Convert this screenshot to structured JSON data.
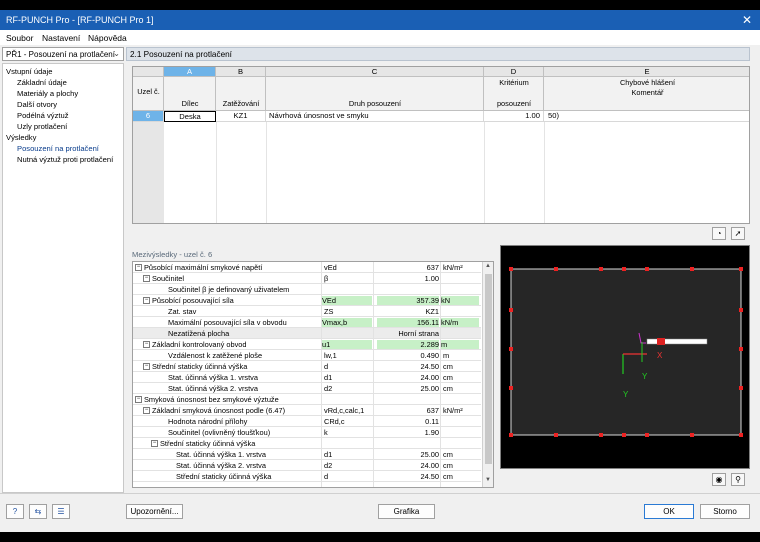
{
  "window": {
    "title": "RF-PUNCH Pro - [RF-PUNCH Pro 1]",
    "close_glyph": "✕"
  },
  "menu": [
    "Soubor",
    "Nastavení",
    "Nápověda"
  ],
  "nav": {
    "selector": "PŘ1 - Posouzení na protlačení",
    "tree": [
      {
        "label": "Vstupní údaje",
        "level": 0
      },
      {
        "label": "Základní údaje",
        "level": 1
      },
      {
        "label": "Materiály a plochy",
        "level": 1
      },
      {
        "label": "Další otvory",
        "level": 1
      },
      {
        "label": "Podélná výztuž",
        "level": 1
      },
      {
        "label": "Uzly protlačení",
        "level": 1
      },
      {
        "label": "Výsledky",
        "level": 0
      },
      {
        "label": "Posouzení na protlačení",
        "level": 1,
        "selected": true
      },
      {
        "label": "Nutná výztuž proti protlačení",
        "level": 1
      }
    ]
  },
  "pane_title": "2.1 Posouzení na protlačení",
  "grid": {
    "col_letters": [
      "A",
      "B",
      "C",
      "D",
      "E"
    ],
    "row_header": "Uzel č.",
    "sub_headers": {
      "A": "Dílec",
      "B": "Zatěžování",
      "C": "Druh posouzení",
      "D1": "Kritérium",
      "D2": "posouzení",
      "E1": "Chybové hlášení",
      "E2": "Komentář"
    },
    "rows": [
      {
        "node": "6",
        "member": "Deska",
        "loading": "KZ1",
        "type": "Návrhová únosnost ve smyku",
        "criterion": "1.00",
        "error_code": "50)"
      }
    ]
  },
  "intermediate": {
    "title": "Mezivýsledky - uzel č. 6",
    "rows": [
      {
        "label": "Působící maximální smykové napětí",
        "indent": 0,
        "toggle": "⊟",
        "sym": "vEd",
        "val": "637",
        "unit": "kN/m²",
        "style": ""
      },
      {
        "label": "Součinitel",
        "indent": 1,
        "toggle": "⊟",
        "sym": "β",
        "val": "1.00",
        "unit": "",
        "style": ""
      },
      {
        "label": "Součinitel β je definovaný uživatelem",
        "indent": 3,
        "toggle": "",
        "sym": "",
        "val": "",
        "unit": "",
        "style": ""
      },
      {
        "label": "Působící posouvající síla",
        "indent": 1,
        "toggle": "⊟",
        "sym": "VEd",
        "val": "357.39",
        "unit": "kN",
        "style": "grn"
      },
      {
        "label": "Zat. stav",
        "indent": 3,
        "toggle": "",
        "sym": "ZS",
        "val": "KZ1",
        "unit": "",
        "style": ""
      },
      {
        "label": "Maximální posouvající síla v obvodu",
        "indent": 3,
        "toggle": "",
        "sym": "Vmax,b",
        "val": "156.11",
        "unit": "kN/m",
        "style": "grn"
      },
      {
        "label": "Nezatížená plocha",
        "indent": 3,
        "toggle": "",
        "sym": "",
        "val": "Horní strana",
        "unit": "",
        "style": "gray"
      },
      {
        "label": "Základní kontrolovaný obvod",
        "indent": 1,
        "toggle": "⊟",
        "sym": "u1",
        "val": "2.289",
        "unit": "m",
        "style": "grn"
      },
      {
        "label": "Vzdálenost k zatěžené ploše",
        "indent": 3,
        "toggle": "",
        "sym": "lw,1",
        "val": "0.490",
        "unit": "m",
        "style": ""
      },
      {
        "label": "Střední staticky účinná výška",
        "indent": 1,
        "toggle": "⊟",
        "sym": "d",
        "val": "24.50",
        "unit": "cm",
        "style": ""
      },
      {
        "label": "Stat. účinná výška 1. vrstva",
        "indent": 3,
        "toggle": "",
        "sym": "d1",
        "val": "24.00",
        "unit": "cm",
        "style": ""
      },
      {
        "label": "Stat. účinná výška 2. vrstva",
        "indent": 3,
        "toggle": "",
        "sym": "d2",
        "val": "25.00",
        "unit": "cm",
        "style": ""
      },
      {
        "label": "Smyková únosnost bez smykové výztuže",
        "indent": 0,
        "toggle": "⊟",
        "sym": "",
        "val": "",
        "unit": "",
        "style": ""
      },
      {
        "label": "Základní smyková únosnost podle (6.47)",
        "indent": 1,
        "toggle": "⊟",
        "sym": "vRd,c,calc,1",
        "val": "637",
        "unit": "kN/m²",
        "style": ""
      },
      {
        "label": "Hodnota národní přílohy",
        "indent": 3,
        "toggle": "",
        "sym": "CRd,c",
        "val": "0.11",
        "unit": "",
        "style": ""
      },
      {
        "label": "Součinitel (ovlivněný tloušťkou)",
        "indent": 3,
        "toggle": "",
        "sym": "k",
        "val": "1.90",
        "unit": "",
        "style": ""
      },
      {
        "label": "Střední staticky účinná výška",
        "indent": 2,
        "toggle": "⊟",
        "sym": "",
        "val": "",
        "unit": "",
        "style": ""
      },
      {
        "label": "Stat. účinná výška 1. vrstva",
        "indent": 4,
        "toggle": "",
        "sym": "d1",
        "val": "25.00",
        "unit": "cm",
        "style": ""
      },
      {
        "label": "Stat. účinná výška 2. vrstva",
        "indent": 4,
        "toggle": "",
        "sym": "d2",
        "val": "24.00",
        "unit": "cm",
        "style": ""
      },
      {
        "label": "Střední staticky účinná výška",
        "indent": 4,
        "toggle": "",
        "sym": "d",
        "val": "24.50",
        "unit": "cm",
        "style": ""
      }
    ]
  },
  "graphic": {
    "axis_x": "X",
    "axis_y": "Y",
    "axis_y2": "Y"
  },
  "buttons": {
    "upozorneni": "Upozornění...",
    "grafika": "Grafika",
    "ok": "OK",
    "storno": "Storno"
  },
  "colors": {
    "title_bar": "#1a5fb4",
    "selected_col": "#6eb3e8",
    "highlight": "#c7f0c7"
  }
}
